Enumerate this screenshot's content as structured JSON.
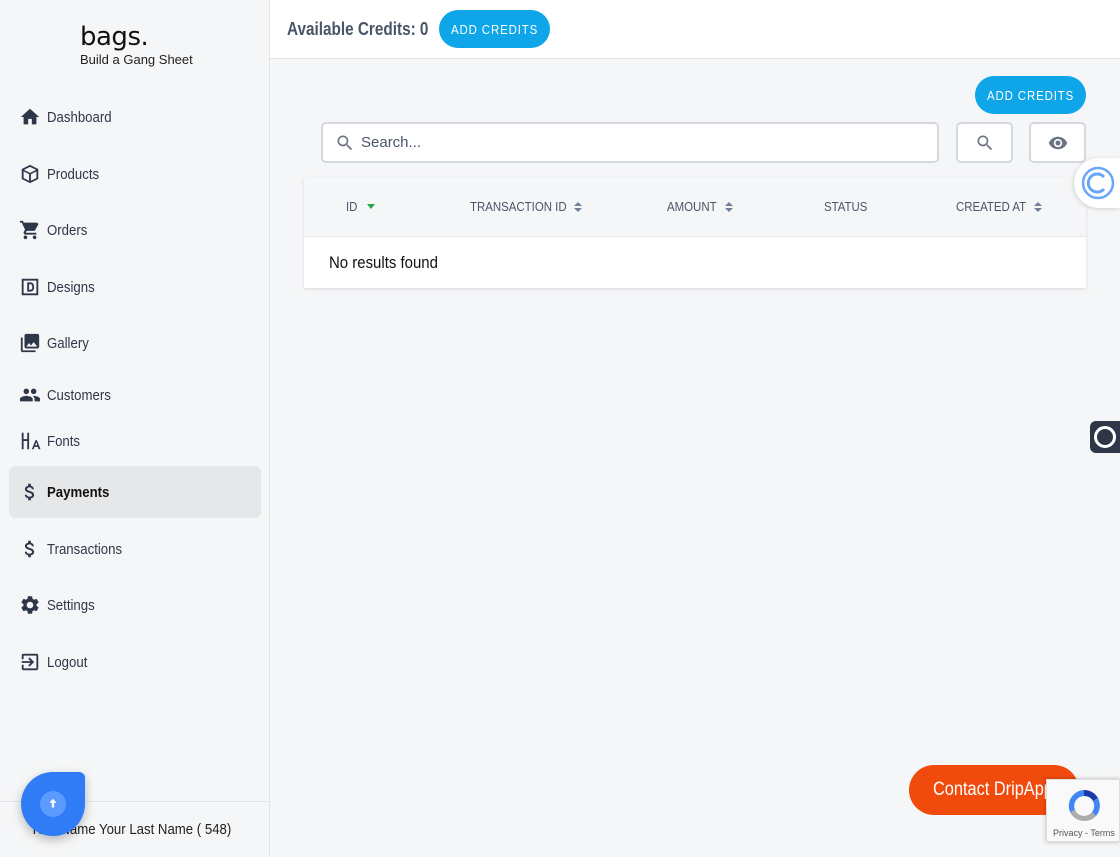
{
  "brand": {
    "name": "bags.",
    "tagline": "Build a Gang Sheet"
  },
  "sidebar": {
    "items": [
      {
        "label": "Dashboard",
        "icon": "home-icon"
      },
      {
        "label": "Products",
        "icon": "box-icon"
      },
      {
        "label": "Orders",
        "icon": "cart-icon"
      },
      {
        "label": "Designs",
        "icon": "designs-icon"
      },
      {
        "label": "Gallery",
        "icon": "gallery-icon"
      },
      {
        "label": "Customers",
        "icon": "users-icon"
      },
      {
        "label": "Fonts",
        "icon": "fonts-icon"
      },
      {
        "label": "Payments",
        "icon": "dollar-icon",
        "active": true
      },
      {
        "label": "Transactions",
        "icon": "dollar-icon"
      },
      {
        "label": "Settings",
        "icon": "gear-icon"
      },
      {
        "label": "Logout",
        "icon": "logout-icon"
      }
    ],
    "user": "Your Name Your Last Name ( 548)"
  },
  "header": {
    "credits_label": "Available Credits: 0",
    "add_credits": "ADD CREDITS"
  },
  "main": {
    "add_credits": "ADD CREDITS",
    "search_placeholder": "Search...",
    "columns": [
      "ID",
      "TRANSACTION ID",
      "AMOUNT",
      "STATUS",
      "CREATED AT"
    ],
    "empty_message": "No results found"
  },
  "contact_button": "Contact DripApp",
  "recaptcha": {
    "links": "Privacy - Terms"
  },
  "colors": {
    "accent": "#0ea5e9",
    "contact": "#f04a0c",
    "sort_active": "#22a745"
  }
}
